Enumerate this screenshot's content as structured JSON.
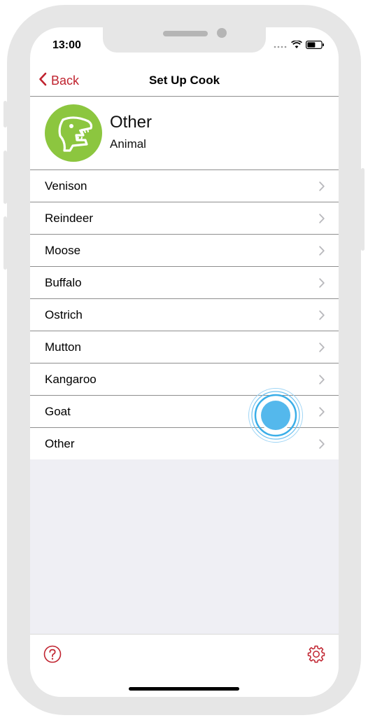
{
  "status_bar": {
    "time": "13:00"
  },
  "nav": {
    "back_label": "Back",
    "title": "Set Up Cook"
  },
  "header": {
    "title": "Other",
    "subtitle": "Animal",
    "avatar_icon": "dinosaur-skull-icon"
  },
  "items": [
    {
      "label": "Venison"
    },
    {
      "label": "Reindeer"
    },
    {
      "label": "Moose"
    },
    {
      "label": "Buffalo"
    },
    {
      "label": "Ostrich"
    },
    {
      "label": "Mutton"
    },
    {
      "label": "Kangaroo"
    },
    {
      "label": "Goat"
    },
    {
      "label": "Other"
    }
  ],
  "toolbar": {
    "help_icon": "help-circle-icon",
    "settings_icon": "gear-icon"
  },
  "colors": {
    "accent": "#c0232f",
    "avatar_bg": "#8cc63f",
    "separator": "#8e8e8e",
    "empty_bg": "#efeff4"
  }
}
